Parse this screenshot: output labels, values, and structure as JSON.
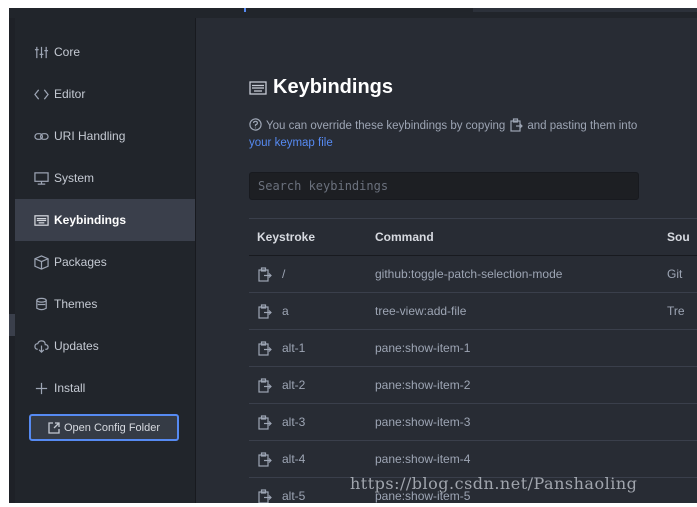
{
  "sidebar": {
    "items": [
      {
        "label": "Core",
        "icon": "sliders-icon"
      },
      {
        "label": "Editor",
        "icon": "code-icon"
      },
      {
        "label": "URI Handling",
        "icon": "link-icon"
      },
      {
        "label": "System",
        "icon": "device-desktop-icon"
      },
      {
        "label": "Keybindings",
        "icon": "keyboard-icon",
        "active": true
      },
      {
        "label": "Packages",
        "icon": "package-icon"
      },
      {
        "label": "Themes",
        "icon": "paintcan-icon"
      },
      {
        "label": "Updates",
        "icon": "cloud-download-icon"
      },
      {
        "label": "Install",
        "icon": "plus-icon"
      }
    ],
    "config_button": "Open Config Folder"
  },
  "main": {
    "title": "Keybindings",
    "info_text_1": "You can override these keybindings by copying",
    "info_text_2": "and pasting them into",
    "info_link": "your keymap file",
    "search_placeholder": "Search keybindings"
  },
  "table": {
    "headers": {
      "keystroke": "Keystroke",
      "command": "Command",
      "source": "Sou"
    },
    "rows": [
      {
        "keystroke": "/",
        "command": "github:toggle-patch-selection-mode",
        "source": "Git"
      },
      {
        "keystroke": "a",
        "command": "tree-view:add-file",
        "source": "Tre"
      },
      {
        "keystroke": "alt-1",
        "command": "pane:show-item-1",
        "source": ""
      },
      {
        "keystroke": "alt-2",
        "command": "pane:show-item-2",
        "source": ""
      },
      {
        "keystroke": "alt-3",
        "command": "pane:show-item-3",
        "source": ""
      },
      {
        "keystroke": "alt-4",
        "command": "pane:show-item-4",
        "source": ""
      },
      {
        "keystroke": "alt-5",
        "command": "pane:show-item-5",
        "source": ""
      }
    ]
  },
  "watermark": "https://blog.csdn.net/Panshaoling",
  "colors": {
    "accent": "#568af2",
    "background": "#282c34",
    "sidebar": "#21252b"
  }
}
